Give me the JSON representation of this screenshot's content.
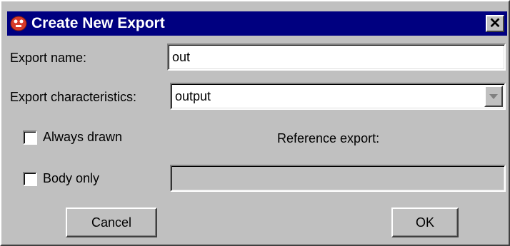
{
  "dialog": {
    "title": "Create New Export",
    "title_icon": "app-logo-icon",
    "close_icon": "close-icon",
    "close_glyph": "✕"
  },
  "form": {
    "export_name_label": "Export name:",
    "export_name_value": "out",
    "characteristics_label": "Export characteristics:",
    "characteristics_value": "output",
    "dropdown_icon": "chevron-down-icon",
    "always_drawn_label": "Always drawn",
    "always_drawn_checked": false,
    "body_only_label": "Body only",
    "body_only_checked": false,
    "reference_export_label": "Reference export:",
    "reference_export_value": ""
  },
  "buttons": {
    "cancel_label": "Cancel",
    "ok_label": "OK"
  },
  "colors": {
    "titlebar": "#000080",
    "window_bg": "#c0c0c0",
    "icon_red": "#d83a2a"
  }
}
